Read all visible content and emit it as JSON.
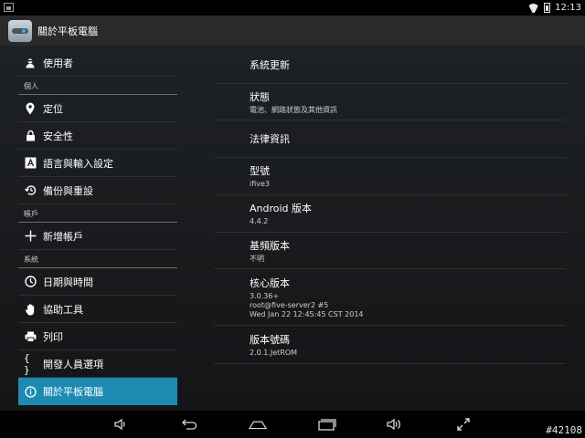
{
  "status_bar": {
    "time": "12:13"
  },
  "action_bar": {
    "title": "關於平板電腦"
  },
  "sidebar": {
    "items": [
      {
        "type": "item",
        "label": "使用者",
        "icon": "user-icon"
      },
      {
        "type": "header",
        "label": "個人"
      },
      {
        "type": "item",
        "label": "定位",
        "icon": "location-pin-icon"
      },
      {
        "type": "item",
        "label": "安全性",
        "icon": "lock-icon"
      },
      {
        "type": "item",
        "label": "語言與輸入設定",
        "icon": "language-icon"
      },
      {
        "type": "item",
        "label": "備份與重設",
        "icon": "backup-restore-icon"
      },
      {
        "type": "header",
        "label": "帳戶"
      },
      {
        "type": "item",
        "label": "新增帳戶",
        "icon": "plus-icon"
      },
      {
        "type": "header",
        "label": "系統"
      },
      {
        "type": "item",
        "label": "日期與時間",
        "icon": "clock-icon"
      },
      {
        "type": "item",
        "label": "協助工具",
        "icon": "hand-icon"
      },
      {
        "type": "item",
        "label": "列印",
        "icon": "printer-icon"
      },
      {
        "type": "item",
        "label": "開發人員選項",
        "icon": "braces-icon"
      },
      {
        "type": "item",
        "label": "關於平板電腦",
        "icon": "info-icon",
        "active": true
      }
    ]
  },
  "content": {
    "rows": [
      {
        "title": "系統更新"
      },
      {
        "title": "狀態",
        "subtitle": "電池、網路狀態及其他資訊"
      },
      {
        "title": "法律資訊"
      },
      {
        "title": "型號",
        "subtitle": "ifive3"
      },
      {
        "title": "Android 版本",
        "subtitle": "4.4.2"
      },
      {
        "title": "基頻版本",
        "subtitle": "不明"
      },
      {
        "title": "核心版本",
        "subtitle": "3.0.36+\nroot@five-server2 #5\nWed Jan 22 12:45:45 CST 2014"
      },
      {
        "title": "版本號碼",
        "subtitle": "2.0.1.JetROM"
      }
    ]
  },
  "nav_bar": {
    "buttons": [
      "volume-down-icon",
      "back-icon",
      "home-icon",
      "recent-apps-icon",
      "volume-up-icon",
      "fullscreen-icon"
    ]
  },
  "watermark": "#42108",
  "colors": {
    "accent": "#1d8ab1",
    "actionbar": "#2a2a2c",
    "background": "#1b1d20"
  }
}
